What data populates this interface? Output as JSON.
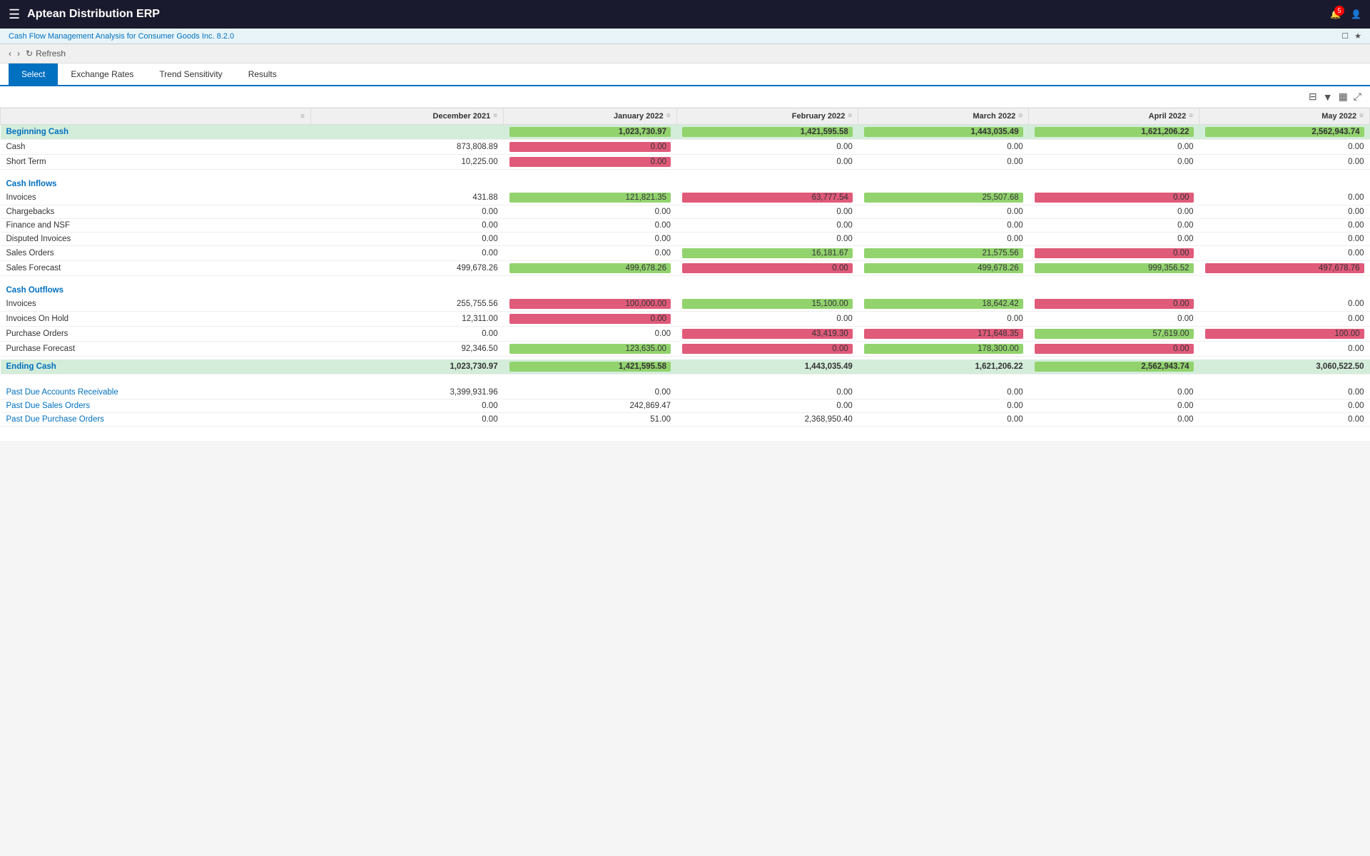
{
  "app": {
    "title": "Aptean Distribution ERP",
    "subtitle": "Cash Flow Management Analysis for Consumer Goods Inc. 8.2.0"
  },
  "nav": {
    "refresh_label": "Refresh",
    "back_label": "←",
    "forward_label": "→"
  },
  "tabs": [
    {
      "id": "select",
      "label": "Select"
    },
    {
      "id": "exchange-rates",
      "label": "Exchange Rates"
    },
    {
      "id": "trend-sensitivity",
      "label": "Trend Sensitivity"
    },
    {
      "id": "results",
      "label": "Results"
    }
  ],
  "active_tab": "results",
  "columns": [
    {
      "label": "",
      "id": "desc"
    },
    {
      "label": "December 2021",
      "id": "dec2021"
    },
    {
      "label": "January 2022",
      "id": "jan2022"
    },
    {
      "label": "February 2022",
      "id": "feb2022"
    },
    {
      "label": "March 2022",
      "id": "mar2022"
    },
    {
      "label": "April 2022",
      "id": "apr2022"
    },
    {
      "label": "May 2022",
      "id": "may2022"
    }
  ],
  "rows": {
    "beginning_cash": {
      "label": "Beginning Cash",
      "dec2021": "",
      "jan2022": "1,023,730.97",
      "feb2022": "1,421,595.58",
      "mar2022": "1,443,035.49",
      "apr2022": "1,621,206.22",
      "may2022": "2,562,943.74"
    },
    "cash": {
      "label": "Cash",
      "dec2021": "873,808.89",
      "jan2022_pink": "0.00",
      "feb2022": "0.00",
      "mar2022": "0.00",
      "apr2022": "0.00",
      "may2022": "0.00"
    },
    "short_term": {
      "label": "Short Term",
      "dec2021": "10,225.00",
      "jan2022_pink": "0.00",
      "feb2022": "0.00",
      "mar2022": "0.00",
      "apr2022": "0.00",
      "may2022": "0.00"
    },
    "cash_inflows_header": "Cash Inflows",
    "invoices_in": {
      "label": "Invoices",
      "dec2021": "431.88",
      "jan2022_green": "121,821.35",
      "feb2022_pink": "63,777.54",
      "mar2022_green": "25,507.68",
      "apr2022_pink": "0.00",
      "may2022": "0.00"
    },
    "chargebacks": {
      "label": "Chargebacks",
      "dec2021": "0.00",
      "jan2022": "0.00",
      "feb2022": "0.00",
      "mar2022": "0.00",
      "apr2022": "0.00",
      "may2022": "0.00"
    },
    "finance_nsf": {
      "label": "Finance and NSF",
      "dec2021": "0.00",
      "jan2022": "0.00",
      "feb2022": "0.00",
      "mar2022": "0.00",
      "apr2022": "0.00",
      "may2022": "0.00"
    },
    "disputed_invoices": {
      "label": "Disputed Invoices",
      "dec2021": "0.00",
      "jan2022": "0.00",
      "feb2022": "0.00",
      "mar2022": "0.00",
      "apr2022": "0.00",
      "may2022": "0.00"
    },
    "sales_orders": {
      "label": "Sales Orders",
      "dec2021": "0.00",
      "jan2022": "0.00",
      "feb2022_green": "16,181.67",
      "mar2022_green": "21,575.56",
      "apr2022_pink": "0.00",
      "may2022": "0.00"
    },
    "sales_forecast": {
      "label": "Sales Forecast",
      "dec2021": "499,678.26",
      "jan2022_green": "499,678.26",
      "feb2022_pink": "0.00",
      "mar2022_green": "499,678.26",
      "apr2022_green": "999,356.52",
      "may2022_pink": "497,678.76"
    },
    "cash_outflows_header": "Cash Outflows",
    "invoices_out": {
      "label": "Invoices",
      "dec2021": "255,755.56",
      "jan2022_pink": "100,000.00",
      "feb2022_green": "15,100.00",
      "mar2022_green": "18,642.42",
      "apr2022_pink": "0.00",
      "may2022": "0.00"
    },
    "invoices_on_hold": {
      "label": "Invoices On Hold",
      "dec2021": "12,311.00",
      "jan2022_pink": "0.00",
      "feb2022": "0.00",
      "mar2022": "0.00",
      "apr2022": "0.00",
      "may2022": "0.00"
    },
    "purchase_orders": {
      "label": "Purchase Orders",
      "dec2021": "0.00",
      "jan2022": "0.00",
      "feb2022_pink": "43,419.30",
      "mar2022_pink": "171,648.35",
      "apr2022_green": "57,619.00",
      "may2022_pink": "100.00"
    },
    "purchase_forecast": {
      "label": "Purchase Forecast",
      "dec2021": "92,346.50",
      "jan2022_green": "123,635.00",
      "feb2022_pink": "0.00",
      "mar2022_green": "178,300.00",
      "apr2022_pink": "0.00",
      "may2022": "0.00"
    },
    "ending_cash": {
      "label": "Ending Cash",
      "dec2021": "1,023,730.97",
      "jan2022_green": "1,421,595.58",
      "feb2022": "1,443,035.49",
      "mar2022": "1,621,206.22",
      "apr2022_green": "2,562,943.74",
      "may2022": "3,060,522.50"
    },
    "past_due_ar": {
      "label": "Past Due Accounts Receivable",
      "dec2021": "3,399,931.96",
      "jan2022": "0.00",
      "feb2022": "0.00",
      "mar2022": "0.00",
      "apr2022": "0.00",
      "may2022": "0.00"
    },
    "past_due_so": {
      "label": "Past Due Sales Orders",
      "dec2021": "0.00",
      "jan2022": "242,869.47",
      "feb2022": "0.00",
      "mar2022": "0.00",
      "apr2022": "0.00",
      "may2022": "0.00"
    },
    "past_due_po": {
      "label": "Past Due Purchase Orders",
      "dec2021": "0.00",
      "jan2022": "51.00",
      "feb2022": "2,368,950.40",
      "mar2022": "0.00",
      "apr2022": "0.00",
      "may2022": "0.00"
    }
  },
  "icons": {
    "menu": "☰",
    "bell": "🔔",
    "user": "👤",
    "back": "‹",
    "forward": "›",
    "refresh": "↻",
    "filter": "⊟",
    "dropdown": "▼",
    "grid": "▦",
    "expand": "⤢",
    "col_menu": "≡"
  },
  "notification_count": "5"
}
